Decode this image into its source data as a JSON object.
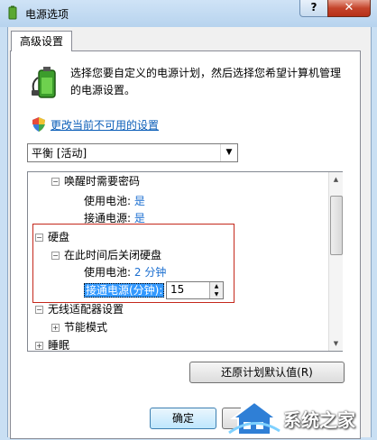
{
  "window": {
    "title": "电源选项",
    "help_label": "?",
    "close_label": "✕"
  },
  "tab": {
    "label": "高级设置"
  },
  "description": "选择您要自定义的电源计划，然后选择您希望计算机管理的电源设置。",
  "change_link": "更改当前不可用的设置",
  "plan_select": {
    "value": "平衡 [活动]"
  },
  "tree": {
    "wake_password": "唤醒时需要密码",
    "wake_battery_label": "使用电池:",
    "wake_battery_value": "是",
    "wake_plugged_label": "接通电源:",
    "wake_plugged_value": "是",
    "hard_disk": "硬盘",
    "turn_off_hdd": "在此时间后关闭硬盘",
    "hdd_battery_label": "使用电池:",
    "hdd_battery_value": "2 分钟",
    "hdd_plugged_label": "接通电源(分钟):",
    "hdd_plugged_value": "15",
    "wireless": "无线适配器设置",
    "power_save_mode": "节能模式",
    "sleep": "睡眠"
  },
  "restore_button": "还原计划默认值(R)",
  "ok_button": "确定",
  "watermark": "系统之家",
  "colors": {
    "link": "#0b5eb8",
    "value": "#1c6fd0",
    "highlight": "#c4281c",
    "selection": "#3399ff"
  }
}
